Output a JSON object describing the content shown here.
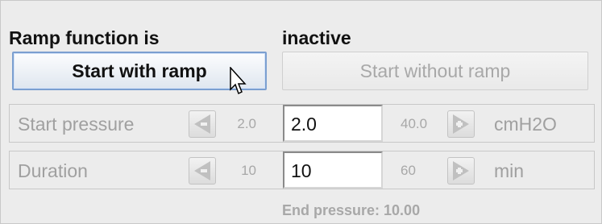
{
  "status": {
    "label": "Ramp function is",
    "value": "inactive"
  },
  "buttons": {
    "start_with_ramp": "Start with ramp",
    "start_without_ramp": "Start without ramp"
  },
  "rows": [
    {
      "label": "Start pressure",
      "min": "2.0",
      "value": "2.0",
      "max": "40.0",
      "unit": "cmH2O"
    },
    {
      "label": "Duration",
      "min": "10",
      "value": "10",
      "max": "60",
      "unit": "min"
    }
  ],
  "end_pressure": "End pressure: 10.00",
  "icons": {
    "decrement": "arrow-left-minus-icon",
    "increment": "arrow-right-plus-icon",
    "cursor": "mouse-pointer-icon"
  },
  "colors": {
    "primary_border": "#7b9fd0",
    "disabled_text": "#a8a8a8"
  }
}
